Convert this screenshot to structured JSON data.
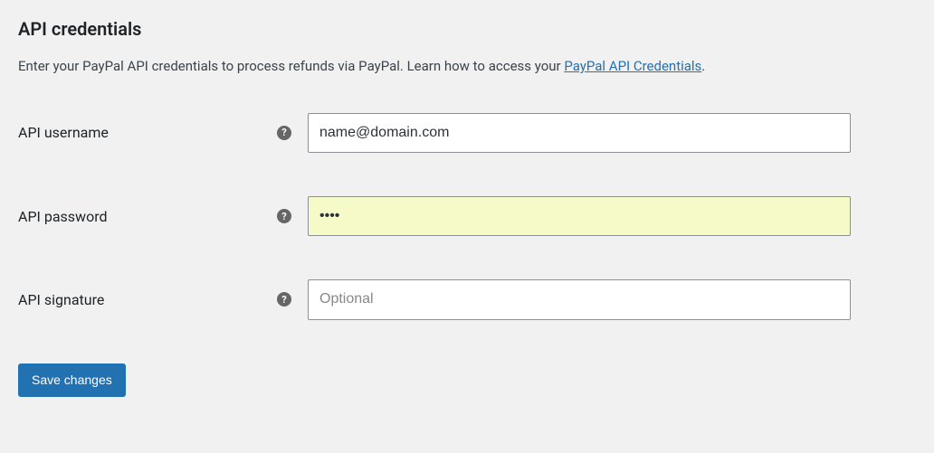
{
  "section": {
    "title": "API credentials",
    "description_prefix": "Enter your PayPal API credentials to process refunds via PayPal. Learn how to access your ",
    "description_link": "PayPal API Credentials",
    "description_suffix": "."
  },
  "fields": {
    "username": {
      "label": "API username",
      "value": "name@domain.com",
      "placeholder": ""
    },
    "password": {
      "label": "API password",
      "value": "••••",
      "placeholder": ""
    },
    "signature": {
      "label": "API signature",
      "value": "",
      "placeholder": "Optional"
    }
  },
  "help_glyph": "?",
  "submit": {
    "label": "Save changes"
  }
}
